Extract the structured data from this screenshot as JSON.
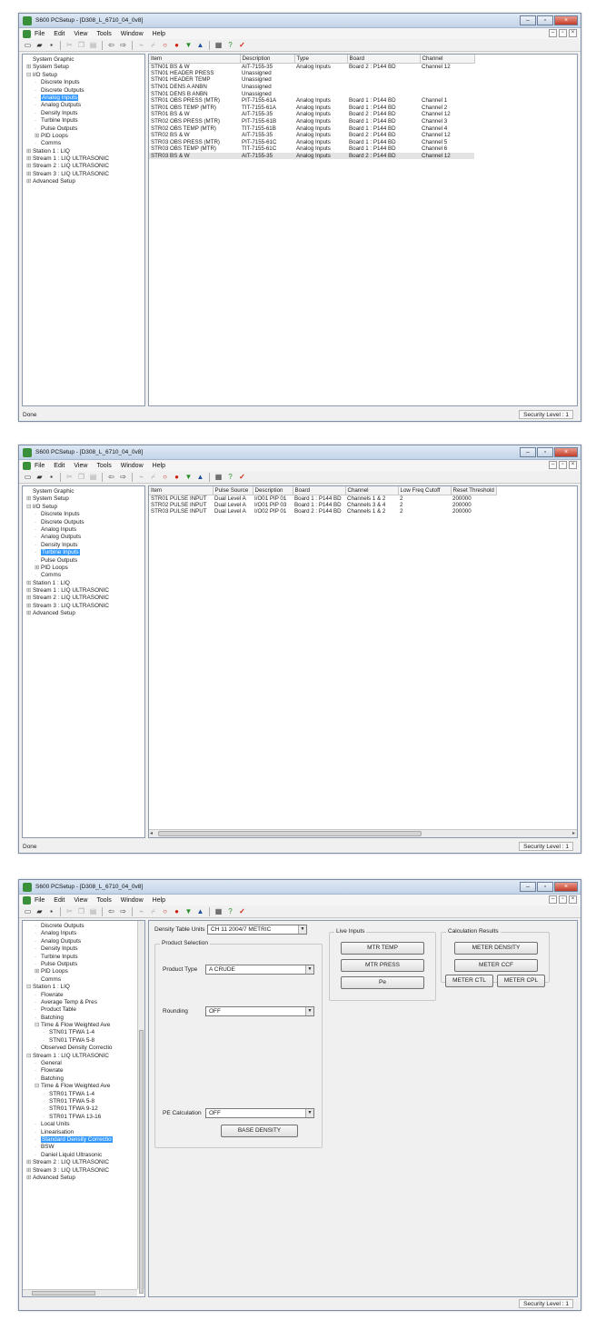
{
  "common": {
    "menu": [
      "File",
      "Edit",
      "View",
      "Tools",
      "Window",
      "Help"
    ],
    "security_level": "Security Level : 1",
    "status_done": "Done",
    "toolbar_icons": [
      "new-icon",
      "open-icon",
      "save-icon",
      "cut-icon",
      "copy-icon",
      "paste-icon",
      "back-icon",
      "forward-icon",
      "connect-icon",
      "disconnect-icon",
      "refresh-icon",
      "stop-icon",
      "download-icon",
      "upload-icon",
      "print-icon",
      "help-icon",
      "info-icon"
    ]
  },
  "windows": [
    {
      "title": "S600 PCSetup - [D308_L_6710_04_0v8]",
      "status": "Done",
      "tree": [
        {
          "label": "System Graphic",
          "level": 0
        },
        {
          "label": "System Setup",
          "level": 0,
          "expander": "+"
        },
        {
          "label": "I/O Setup",
          "level": 0,
          "expander": "-"
        },
        {
          "label": "Discrete Inputs",
          "level": 1
        },
        {
          "label": "Discrete Outputs",
          "level": 1
        },
        {
          "label": "Analog Inputs",
          "level": 1,
          "selected": true
        },
        {
          "label": "Analog Outputs",
          "level": 1
        },
        {
          "label": "Density Inputs",
          "level": 1
        },
        {
          "label": "Turbine Inputs",
          "level": 1
        },
        {
          "label": "Pulse Outputs",
          "level": 1
        },
        {
          "label": "PID Loops",
          "level": 1,
          "expander": "+"
        },
        {
          "label": "Comms",
          "level": 1
        },
        {
          "label": "Station 1 : LIQ",
          "level": 0,
          "expander": "+"
        },
        {
          "label": "Stream 1 : LIQ ULTRASONIC",
          "level": 0,
          "expander": "+"
        },
        {
          "label": "Stream 2 : LIQ ULTRASONIC",
          "level": 0,
          "expander": "+"
        },
        {
          "label": "Stream 3 : LIQ ULTRASONIC",
          "level": 0,
          "expander": "+"
        },
        {
          "label": "Advanced Setup",
          "level": 0,
          "expander": "+"
        }
      ],
      "columns": [
        "Item",
        "Description",
        "Type",
        "Board",
        "Channel"
      ],
      "rows": [
        [
          "STN01 BS & W",
          "AIT-7155-35",
          "Analog Inputs",
          "Board 2 : P144 BD",
          "Channel 12"
        ],
        [
          "STN01 HEADER PRESS",
          "Unassigned",
          "",
          "",
          ""
        ],
        [
          "STN01 HEADER TEMP",
          "Unassigned",
          "",
          "",
          ""
        ],
        [
          "STN01 DENS A ANBN",
          "Unassigned",
          "",
          "",
          ""
        ],
        [
          "STN01 DENS B ANBN",
          "Unassigned",
          "",
          "",
          ""
        ],
        [
          "STR01 OBS PRESS (MTR)",
          "PIT-7155-61A",
          "Analog Inputs",
          "Board 1 : P144 BD",
          "Channel 1"
        ],
        [
          "STR01 OBS TEMP (MTR)",
          "TIT-7155-61A",
          "Analog Inputs",
          "Board 1 : P144 BD",
          "Channel 2"
        ],
        [
          "STR01 BS & W",
          "AIT-7155-35",
          "Analog Inputs",
          "Board 2 : P144 BD",
          "Channel 12"
        ],
        [
          "STR02 OBS PRESS (MTR)",
          "PIT-7155-61B",
          "Analog Inputs",
          "Board 1 : P144 BD",
          "Channel 3"
        ],
        [
          "STR02 OBS TEMP (MTR)",
          "TIT-7155-61B",
          "Analog Inputs",
          "Board 1 : P144 BD",
          "Channel 4"
        ],
        [
          "STR02 BS & W",
          "AIT-7155-35",
          "Analog Inputs",
          "Board 2 : P144 BD",
          "Channel 12"
        ],
        [
          "STR03 OBS PRESS (MTR)",
          "PIT-7155-61C",
          "Analog Inputs",
          "Board 1 : P144 BD",
          "Channel 5"
        ],
        [
          "STR03 OBS TEMP (MTR)",
          "TIT-7155-61C",
          "Analog Inputs",
          "Board 1 : P144 BD",
          "Channel 6"
        ],
        [
          "STR03 BS & W",
          "AIT-7155-35",
          "Analog Inputs",
          "Board 2 : P144 BD",
          "Channel 12"
        ]
      ]
    },
    {
      "title": "S600 PCSetup - [D308_L_6710_04_0v8]",
      "status": "Done",
      "tree": [
        {
          "label": "System Graphic",
          "level": 0
        },
        {
          "label": "System Setup",
          "level": 0,
          "expander": "+"
        },
        {
          "label": "I/O Setup",
          "level": 0,
          "expander": "-"
        },
        {
          "label": "Discrete Inputs",
          "level": 1
        },
        {
          "label": "Discrete Outputs",
          "level": 1
        },
        {
          "label": "Analog Inputs",
          "level": 1
        },
        {
          "label": "Analog Outputs",
          "level": 1
        },
        {
          "label": "Density Inputs",
          "level": 1
        },
        {
          "label": "Turbine Inputs",
          "level": 1,
          "selected": true
        },
        {
          "label": "Pulse Outputs",
          "level": 1
        },
        {
          "label": "PID Loops",
          "level": 1,
          "expander": "+"
        },
        {
          "label": "Comms",
          "level": 1
        },
        {
          "label": "Station 1 : LIQ",
          "level": 0,
          "expander": "+"
        },
        {
          "label": "Stream 1 : LIQ ULTRASONIC",
          "level": 0,
          "expander": "+"
        },
        {
          "label": "Stream 2 : LIQ ULTRASONIC",
          "level": 0,
          "expander": "+"
        },
        {
          "label": "Stream 3 : LIQ ULTRASONIC",
          "level": 0,
          "expander": "+"
        },
        {
          "label": "Advanced Setup",
          "level": 0,
          "expander": "+"
        }
      ],
      "columns": [
        "Item",
        "Pulse Source",
        "Description",
        "Board",
        "Channel",
        "Low Freq Cutoff",
        "Reset Threshold"
      ],
      "rows": [
        [
          "STR01 PULSE INPUT",
          "Dual Level A",
          "I/O01 PIP 01",
          "Board 1 : P144 BD",
          "Channels 1 & 2",
          "2",
          "200000"
        ],
        [
          "STR02 PULSE INPUT",
          "Dual Level A",
          "I/O01 PIP 03",
          "Board 1 : P144 BD",
          "Channels 3 & 4",
          "2",
          "200000"
        ],
        [
          "STR03 PULSE INPUT",
          "Dual Level A",
          "I/O02 PIP 01",
          "Board 2 : P144 BD",
          "Channels 1 & 2",
          "2",
          "200000"
        ]
      ]
    },
    {
      "title": "S600 PCSetup - [D308_L_6710_04_0v8]",
      "tree": [
        {
          "label": "Discrete Outputs",
          "level": 1
        },
        {
          "label": "Analog Inputs",
          "level": 1
        },
        {
          "label": "Analog Outputs",
          "level": 1
        },
        {
          "label": "Density Inputs",
          "level": 1
        },
        {
          "label": "Turbine Inputs",
          "level": 1
        },
        {
          "label": "Pulse Outputs",
          "level": 1
        },
        {
          "label": "PID Loops",
          "level": 1,
          "expander": "+"
        },
        {
          "label": "Comms",
          "level": 1
        },
        {
          "label": "Station 1 : LIQ",
          "level": 0,
          "expander": "-"
        },
        {
          "label": "Flowrate",
          "level": 1
        },
        {
          "label": "Average Temp & Pres",
          "level": 1
        },
        {
          "label": "Product Table",
          "level": 1
        },
        {
          "label": "Batching",
          "level": 1
        },
        {
          "label": "Time & Flow Weighted Ave",
          "level": 1,
          "expander": "-"
        },
        {
          "label": "STN01 TFWA 1-4",
          "level": 2
        },
        {
          "label": "STN01 TFWA 5-8",
          "level": 2
        },
        {
          "label": "Observed Density Correctio",
          "level": 1
        },
        {
          "label": "Stream 1 : LIQ ULTRASONIC",
          "level": 0,
          "expander": "-"
        },
        {
          "label": "General",
          "level": 1
        },
        {
          "label": "Flowrate",
          "level": 1
        },
        {
          "label": "Batching",
          "level": 1
        },
        {
          "label": "Time & Flow Weighted Ave",
          "level": 1,
          "expander": "-"
        },
        {
          "label": "STR01 TFWA 1-4",
          "level": 2
        },
        {
          "label": "STR01 TFWA 5-8",
          "level": 2
        },
        {
          "label": "STR01 TFWA 9-12",
          "level": 2
        },
        {
          "label": "STR01 TFWA 13-16",
          "level": 2
        },
        {
          "label": "Local Units",
          "level": 1
        },
        {
          "label": "Linearisation",
          "level": 1
        },
        {
          "label": "Standard Density Correctio",
          "level": 1,
          "selected": true
        },
        {
          "label": "BSW",
          "level": 1
        },
        {
          "label": "Daniel Liquid Ultrasonic",
          "level": 1
        },
        {
          "label": "Stream 2 : LIQ ULTRASONIC",
          "level": 0,
          "expander": "+"
        },
        {
          "label": "Stream 3 : LIQ ULTRASONIC",
          "level": 0,
          "expander": "+"
        },
        {
          "label": "Advanced Setup",
          "level": 0,
          "expander": "+"
        }
      ],
      "form": {
        "density_table_units_label": "Density Table Units",
        "density_table_units_value": "CH 11 2004/7 METRIC",
        "product_selection_title": "Product Selection",
        "product_type_label": "Product Type",
        "product_type_value": "A CRUDE",
        "rounding_label": "Rounding",
        "rounding_value": "OFF",
        "pe_calc_label": "PE Calculation",
        "pe_calc_value": "OFF",
        "base_density_button": "BASE DENSITY",
        "live_inputs_title": "Live Inputs",
        "live_inputs": [
          "MTR TEMP",
          "MTR PRESS",
          "Pe"
        ],
        "calc_results_title": "Calculation Results",
        "calc_results": [
          "METER DENSITY",
          "METER CCF",
          "METER CTL",
          "METER CPL"
        ]
      }
    }
  ]
}
